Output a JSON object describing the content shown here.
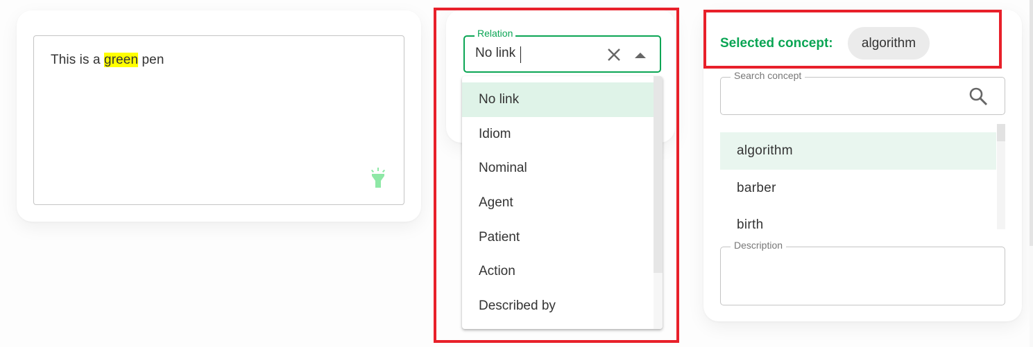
{
  "sentence_panel": {
    "text_before": "This is a ",
    "highlighted_word": "green",
    "text_after": " pen",
    "highlight_color": "#ffff00",
    "hint_icon": "flashlight-icon"
  },
  "relation_panel": {
    "label": "Relation",
    "value": "No link",
    "accent_color": "#0aa554",
    "clear_icon": "close-icon",
    "toggle_icon": "arrow-up-icon",
    "options": [
      {
        "label": "No link",
        "selected": true
      },
      {
        "label": "Idiom",
        "selected": false
      },
      {
        "label": "Nominal",
        "selected": false
      },
      {
        "label": "Agent",
        "selected": false
      },
      {
        "label": "Patient",
        "selected": false
      },
      {
        "label": "Action",
        "selected": false
      },
      {
        "label": "Described by",
        "selected": false
      }
    ]
  },
  "concept_panel": {
    "selected_label": "Selected concept:",
    "selected_value": "algorithm",
    "search": {
      "label": "Search concept",
      "value": "",
      "icon": "search-icon"
    },
    "concepts": [
      {
        "label": "algorithm",
        "selected": true
      },
      {
        "label": "barber",
        "selected": false
      },
      {
        "label": "birth",
        "selected": false
      }
    ],
    "description": {
      "label": "Description",
      "value": ""
    }
  },
  "annotation_color": "#e8202a"
}
